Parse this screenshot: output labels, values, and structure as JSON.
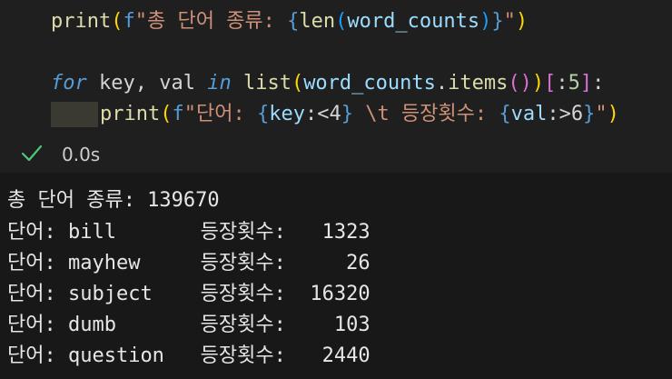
{
  "code": {
    "line1": {
      "print": "print",
      "open": "(",
      "fprefix": "f",
      "str_a": "\"총 단어 종류: ",
      "brace_open": "{",
      "len": "len",
      "p_open": "(",
      "word_counts": "word_counts",
      "p_close": ")",
      "brace_close": "}",
      "str_b": "\"",
      "close": ")"
    },
    "line2": {
      "for": "for",
      "mid": " key, val ",
      "in": "in",
      "sp": " ",
      "list": "list",
      "p_open": "(",
      "word_counts": "word_counts",
      "dot": ".",
      "items": "items",
      "call": "()",
      "p_close": ")",
      "slice_open": "[",
      "colon": ":",
      "five": "5",
      "slice_close": "]",
      "end": ":"
    },
    "line3": {
      "print": "print",
      "open": "(",
      "fprefix": "f",
      "str_a": "\"단어: ",
      "brace1_open": "{",
      "key": "key",
      "fmt1": ":<4",
      "brace1_close": "}",
      "str_b": " \\t 등장횟수: ",
      "brace2_open": "{",
      "val": "val",
      "fmt2": ":>6",
      "brace2_close": "}",
      "str_c": "\"",
      "close": ")"
    }
  },
  "status": {
    "icon": "check-icon",
    "timing": "0.0s"
  },
  "output": {
    "lines": [
      "총 단어 종류: 139670",
      "단어: bill       등장횟수:   1323",
      "단어: mayhew     등장횟수:     26",
      "단어: subject    등장횟수:  16320",
      "단어: dumb       등장횟수:    103",
      "단어: question   등장횟수:   2440"
    ]
  },
  "colors": {
    "background": "#1e1e1e",
    "function": "#dcdcaa",
    "string": "#ce9178",
    "keyword": "#c586c0",
    "success": "#4ec97b"
  }
}
